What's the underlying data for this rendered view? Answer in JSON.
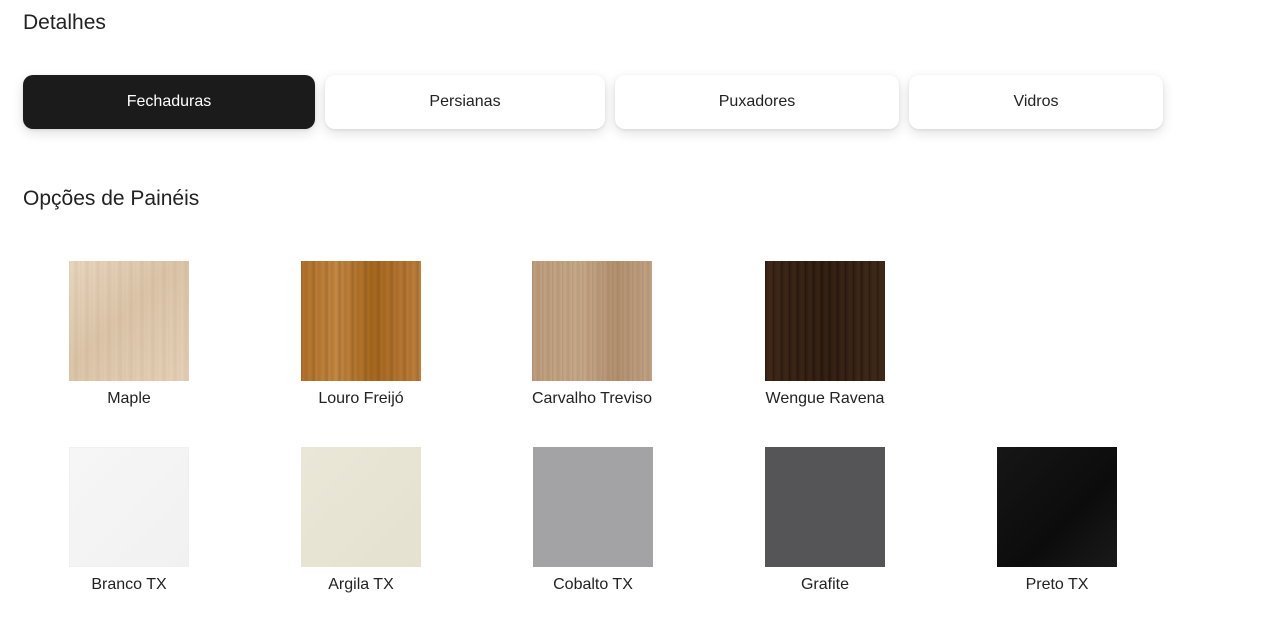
{
  "details": {
    "title": "Detalhes",
    "tabs": [
      {
        "label": "Fechaduras",
        "active": true
      },
      {
        "label": "Persianas",
        "active": false
      },
      {
        "label": "Puxadores",
        "active": false
      },
      {
        "label": "Vidros",
        "active": false
      }
    ]
  },
  "panels": {
    "title": "Opções de Painéis",
    "rows": [
      [
        {
          "name": "Maple",
          "color": "#e2cdb3"
        },
        {
          "name": "Louro Freijó",
          "color": "#b57a35"
        },
        {
          "name": "Carvalho Treviso",
          "color": "#c2a282"
        },
        {
          "name": "Wengue Ravena",
          "color": "#33200f"
        }
      ],
      [
        {
          "name": "Branco TX",
          "color": "#f4f4f4"
        },
        {
          "name": "Argila TX",
          "color": "#e8e4d4"
        },
        {
          "name": "Cobalto TX",
          "color": "#a3a2a5"
        },
        {
          "name": "Grafite",
          "color": "#555456"
        },
        {
          "name": "Preto TX",
          "color": "#121212"
        }
      ]
    ]
  }
}
